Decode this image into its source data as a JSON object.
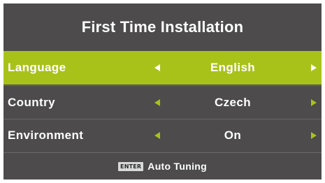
{
  "dialog": {
    "title": "First Time Installation"
  },
  "settings": [
    {
      "label": "Language",
      "value": "English",
      "selected": true
    },
    {
      "label": "Country",
      "value": "Czech",
      "selected": false
    },
    {
      "label": "Environment",
      "value": "On",
      "selected": false
    }
  ],
  "footer": {
    "key_label": "ENTER",
    "action_text": "Auto Tuning"
  },
  "colors": {
    "panel_bg": "#4d4b4b",
    "highlight": "#a9c21a",
    "text": "#ffffff"
  },
  "icons": {
    "left_arrow": "triangle-left-icon",
    "right_arrow": "triangle-right-icon"
  }
}
